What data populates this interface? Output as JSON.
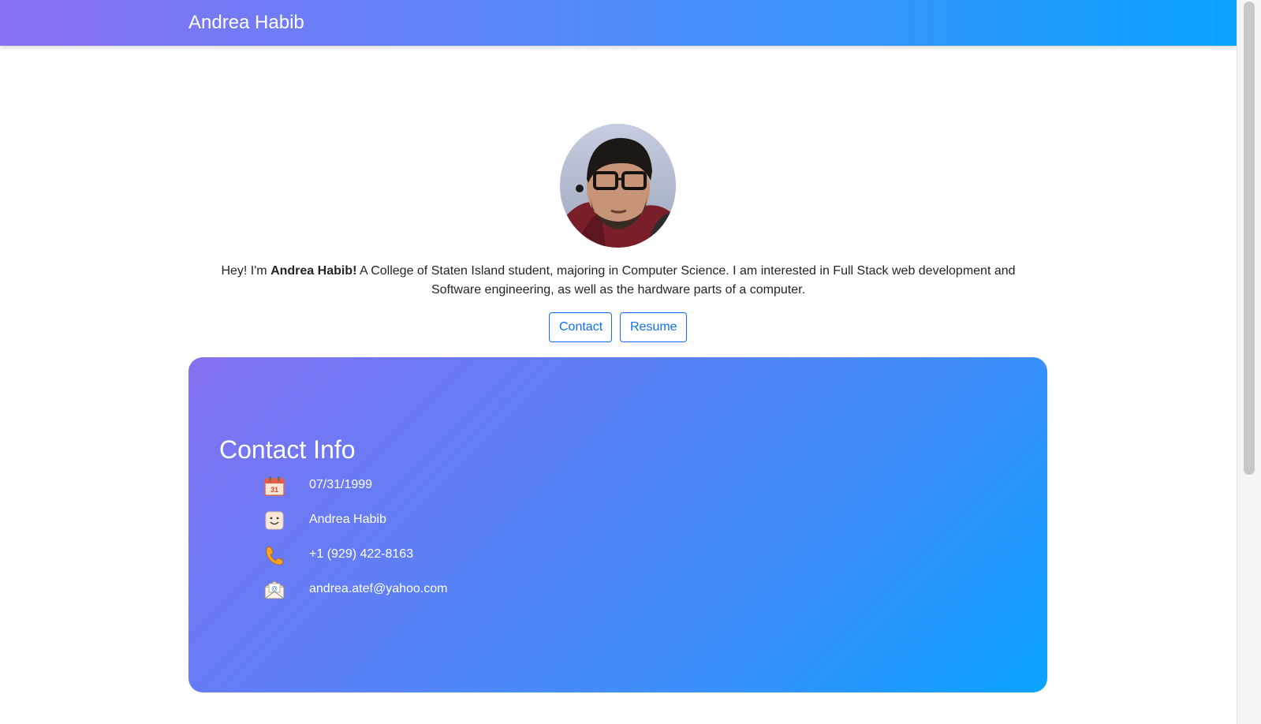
{
  "navbar": {
    "brand": "Andrea Habib"
  },
  "hero": {
    "intro_prefix": "Hey! I'm ",
    "intro_name": "Andrea Habib!",
    "intro_rest": " A College of Staten Island student, majoring in Computer Science. I am interested in Full Stack web development and Software engineering, as well as the hardware parts of a computer.",
    "buttons": {
      "contact": "Contact",
      "resume": "Resume"
    }
  },
  "contact_info": {
    "title": "Contact Info",
    "items": [
      {
        "icon": "calendar-icon",
        "text": "07/31/1999"
      },
      {
        "icon": "face-icon",
        "text": "Andrea Habib"
      },
      {
        "icon": "phone-icon",
        "text": "+1 (929) 422-8163"
      },
      {
        "icon": "mail-icon",
        "text": "andrea.atef@yahoo.com"
      }
    ]
  },
  "colors": {
    "gradient_start": "#8a6ff2",
    "gradient_end": "#0aa4ff",
    "button_outline": "#0d6efd"
  }
}
